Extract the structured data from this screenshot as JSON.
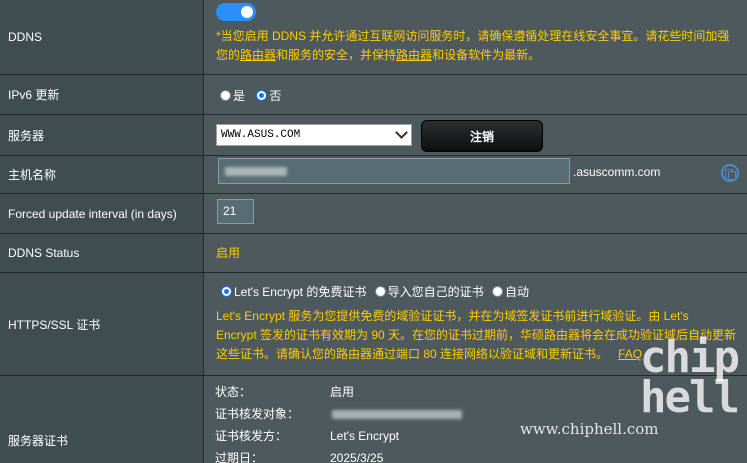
{
  "ddns": {
    "label": "DDNS",
    "enabled": true,
    "warning_part1": "*当您启用 DDNS 并允许通过互联网访问服务时，请确保遵循处理在线安全事宜。请花些时间加强",
    "warning_part2a": "您的",
    "warning_router1": "路由器",
    "warning_part2b": "和服务的安全，并保持",
    "warning_router2": "路由器",
    "warning_part2c": "和设备软件为最新。"
  },
  "ipv6": {
    "label": "IPv6 更新",
    "option_yes": "是",
    "option_no": "否",
    "selected": "否"
  },
  "server": {
    "label": "服务器",
    "selected": "WWW.ASUS.COM",
    "register_button": "注销"
  },
  "hostname": {
    "label": "主机名称",
    "suffix": ".asuscomm.com"
  },
  "forced_update": {
    "label": "Forced update interval (in days)",
    "value": "21"
  },
  "ddns_status": {
    "label": "DDNS Status",
    "value": "启用"
  },
  "https_ssl": {
    "label": "HTTPS/SSL 证书",
    "option_le": "Let's Encrypt 的免费证书",
    "option_import": "导入您自己的证书",
    "option_auto": "自动",
    "selected": "Let's Encrypt 的免费证书",
    "desc_line1": "Let's Encrypt 服务为您提供免费的域验证证书，并在为域签发证书前进行域验证。由 Let's",
    "desc_line2": "Encrypt 签发的证书有效期为 90 天。在您的证书过期前，华硕路由器将会在成功验证域后自动更新",
    "desc_line3": "这些证书。请确认您的路由器通过端口 80 连接网络以验证域和更新证书。",
    "faq": "FAQ"
  },
  "server_cert": {
    "label": "服务器证书",
    "status_key": "状态：",
    "status_val": "启用",
    "issued_to_key": "证书核发对象：",
    "issuer_key": "证书核发方：",
    "issuer_val": "Let's Encrypt",
    "expiry_key": "过期日：",
    "expiry_val": "2025/3/25"
  },
  "watermark": {
    "text_line1": "chip",
    "text_line2": "hell",
    "url": "www.chiphell.com"
  }
}
